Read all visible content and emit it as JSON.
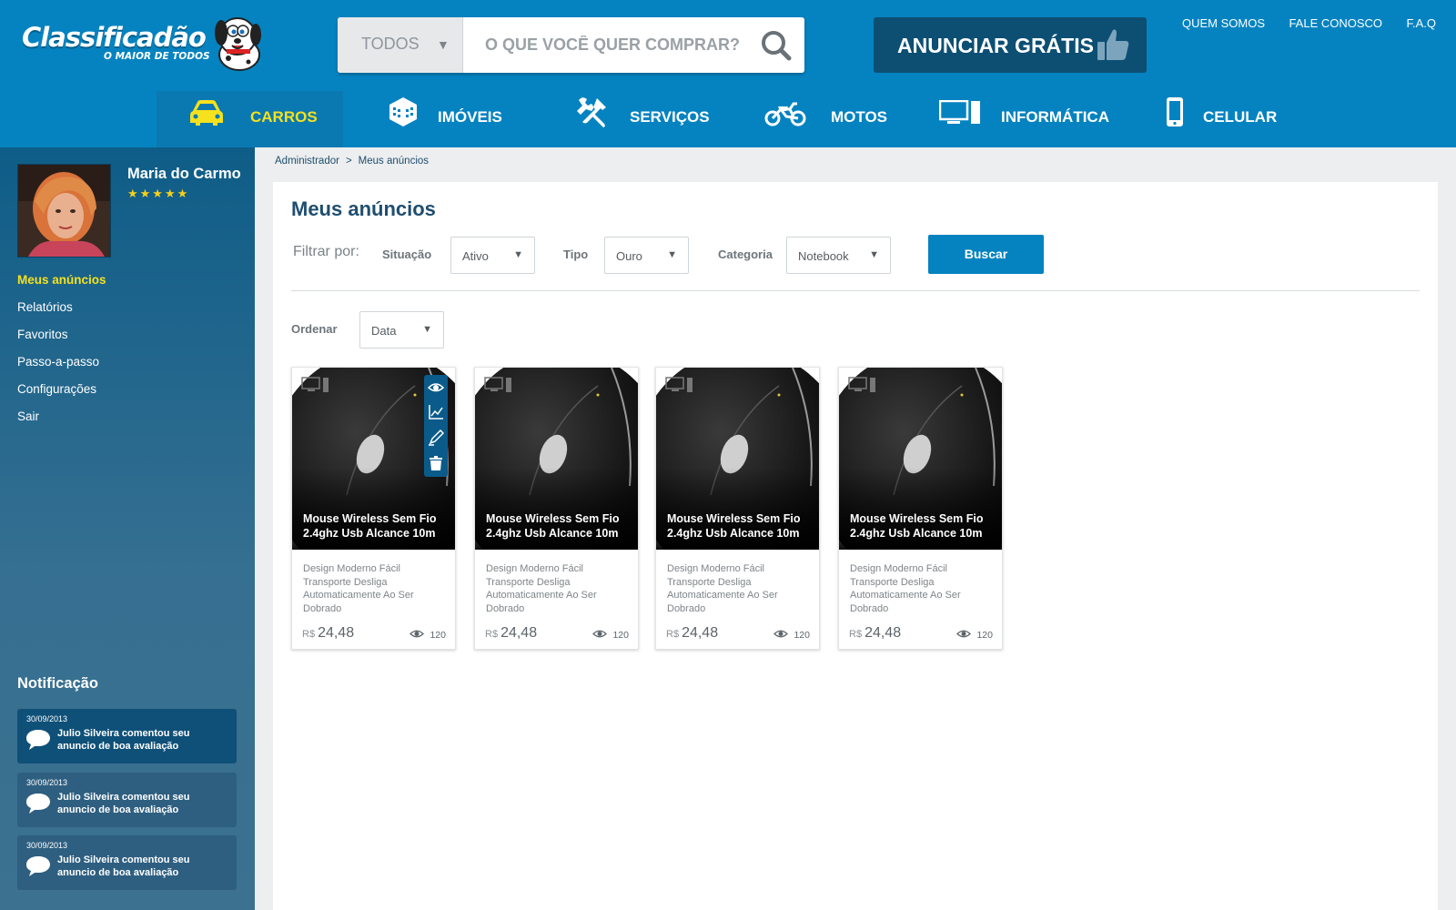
{
  "brand": {
    "name": "Classificadão",
    "tagline": "O MAIOR DE TODOS"
  },
  "search": {
    "category": "TODOS",
    "placeholder": "O QUE VOCÊ QUER COMPRAR?",
    "icon": "search-icon"
  },
  "cta": {
    "label": "ANUNCIAR GRÁTIS",
    "icon": "thumbs-up-icon"
  },
  "top_links": [
    "QUEM SOMOS",
    "FALE CONOSCO",
    "F.A.Q"
  ],
  "categories": [
    {
      "label": "CARROS",
      "icon": "car-icon",
      "active": true
    },
    {
      "label": "IMÓVEIS",
      "icon": "building-icon",
      "active": false
    },
    {
      "label": "SERVIÇOS",
      "icon": "tools-icon",
      "active": false
    },
    {
      "label": "MOTOS",
      "icon": "motorcycle-icon",
      "active": false
    },
    {
      "label": "INFORMÁTICA",
      "icon": "computer-icon",
      "active": false
    },
    {
      "label": "CELULAR",
      "icon": "cellphone-icon",
      "active": false
    }
  ],
  "user": {
    "name": "Maria do Carmo",
    "rating": 5,
    "stars": "★★★★★"
  },
  "side_menu": [
    {
      "label": "Meus anúncios",
      "active": true
    },
    {
      "label": "Relatórios",
      "active": false
    },
    {
      "label": "Favoritos",
      "active": false
    },
    {
      "label": "Passo-a-passo",
      "active": false
    },
    {
      "label": "Configurações",
      "active": false
    },
    {
      "label": "Sair",
      "active": false
    }
  ],
  "notifications": {
    "title": "Notificação",
    "items": [
      {
        "date": "30/09/2013",
        "text": "Julio Silveira comentou seu anuncio de boa avaliação"
      },
      {
        "date": "30/09/2013",
        "text": "Julio Silveira comentou seu anuncio de boa avaliação"
      },
      {
        "date": "30/09/2013",
        "text": "Julio Silveira comentou seu anuncio de boa avaliação"
      }
    ]
  },
  "breadcrumb": {
    "items": [
      "Administrador",
      "Meus anúncios"
    ],
    "separator": ">"
  },
  "page": {
    "title": "Meus anúncios"
  },
  "filters": {
    "label": "Filtrar por:",
    "situacao": {
      "label": "Situação",
      "value": "Ativo"
    },
    "tipo": {
      "label": "Tipo",
      "value": "Ouro"
    },
    "categoria": {
      "label": "Categoria",
      "value": "Notebook"
    },
    "button": "Buscar"
  },
  "order": {
    "label": "Ordenar",
    "value": "Data"
  },
  "listings": [
    {
      "title": "Mouse Wireless Sem Fio 2.4ghz Usb Alcance 10m",
      "description": "Design Moderno Fácil Transporte Desliga Automaticamente Ao Ser Dobrado",
      "currency": "R$",
      "price": "24,48",
      "views": "120",
      "category_icon": "computer-icon"
    },
    {
      "title": "Mouse Wireless Sem Fio 2.4ghz Usb Alcance 10m",
      "description": "Design Moderno Fácil Transporte Desliga Automaticamente Ao Ser Dobrado",
      "currency": "R$",
      "price": "24,48",
      "views": "120",
      "category_icon": "computer-icon"
    },
    {
      "title": "Mouse Wireless Sem Fio 2.4ghz Usb Alcance 10m",
      "description": "Design Moderno Fácil Transporte Desliga Automaticamente Ao Ser Dobrado",
      "currency": "R$",
      "price": "24,48",
      "views": "120",
      "category_icon": "computer-icon"
    },
    {
      "title": "Mouse Wireless Sem Fio 2.4ghz Usb Alcance 10m",
      "description": "Design Moderno Fácil Transporte Desliga Automaticamente Ao Ser Dobrado",
      "currency": "R$",
      "price": "24,48",
      "views": "120",
      "category_icon": "computer-icon"
    }
  ],
  "card_actions": [
    "view-icon",
    "chart-icon",
    "edit-icon",
    "trash-icon"
  ],
  "colors": {
    "header": "#0583c0",
    "accent_yellow": "#f5e11d",
    "dark_blue": "#0c4f73",
    "sidebar": "#356f91"
  }
}
